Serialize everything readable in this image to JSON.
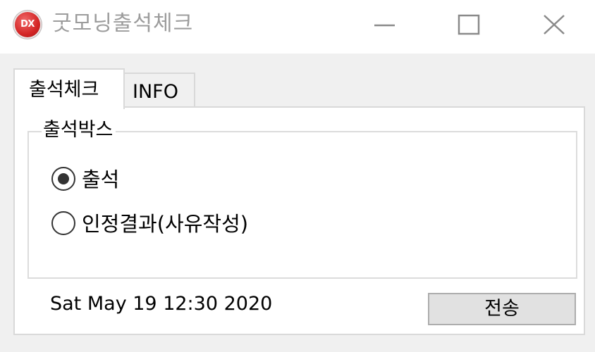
{
  "window": {
    "title": "굿모닝출석체크",
    "icon_text": "DX",
    "icon_name": "app-logo-icon",
    "controls": {
      "minimize": "minimize-icon",
      "maximize": "maximize-icon",
      "close": "close-icon"
    }
  },
  "tabs": [
    {
      "label": "출석체크",
      "active": true
    },
    {
      "label": "INFO",
      "active": false
    }
  ],
  "group": {
    "label": "출석박스",
    "options": [
      {
        "label": "출석",
        "selected": true
      },
      {
        "label": "인정결과(사유작성)",
        "selected": false
      }
    ]
  },
  "footer": {
    "datetime": "Sat May 19 12:30 2020",
    "send_label": "전송"
  },
  "colors": {
    "titlebar_bg": "#ffffff",
    "window_bg": "#f0f0f0",
    "title_text": "#9c9c9c",
    "icon_red": "#d42626",
    "button_bg": "#e1e1e1",
    "button_border": "#adadad"
  }
}
